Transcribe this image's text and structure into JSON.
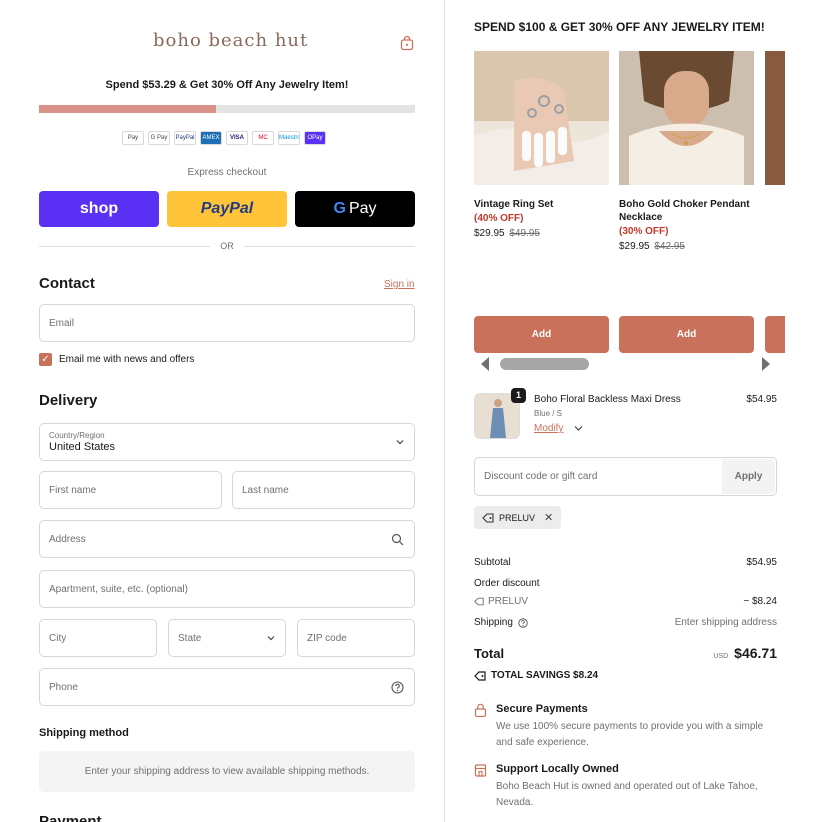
{
  "brand": "boho beach hut",
  "progress": {
    "text": "Spend $53.29 & Get 30% Off Any Jewelry Item!",
    "fraction": 0.47
  },
  "payment_icons": [
    "Pay",
    "G Pay",
    "PayPal",
    "AMEX",
    "VISA",
    "MC",
    "Maestro",
    "OPay"
  ],
  "express": {
    "label": "Express checkout",
    "shop": "shop",
    "paypal": "PayPal",
    "gpay": "Pay",
    "or": "OR"
  },
  "contact": {
    "heading": "Contact",
    "sign_in": "Sign in",
    "email_placeholder": "Email",
    "newsletter": "Email me with news and offers",
    "newsletter_checked": true
  },
  "delivery": {
    "heading": "Delivery",
    "country_caption": "Country/Region",
    "country_value": "United States",
    "first_name": "First name",
    "last_name": "Last name",
    "address": "Address",
    "apartment": "Apartment, suite, etc. (optional)",
    "city": "City",
    "state": "State",
    "zip": "ZIP code",
    "phone": "Phone"
  },
  "shipping_method": {
    "heading": "Shipping method",
    "message": "Enter your shipping address to view available shipping methods."
  },
  "payment_heading": "Payment",
  "upsell": {
    "title": "SPEND $100 & GET 30% OFF ANY JEWELRY ITEM!",
    "products": [
      {
        "name": "Vintage Ring Set",
        "discount": "(40% OFF)",
        "price": "$29.95",
        "compare": "$49.95",
        "button": "Add"
      },
      {
        "name": "Boho Gold Choker Pendant Necklace",
        "discount": "(30% OFF)",
        "price": "$29.95",
        "compare": "$42.95",
        "button": "Add"
      }
    ]
  },
  "cart": {
    "item": {
      "quantity": "1",
      "name": "Boho Floral Backless Maxi Dress",
      "variant": "Blue / S",
      "modify": "Modify",
      "price": "$54.95"
    },
    "discount_placeholder": "Discount code or gift card",
    "apply": "Apply",
    "applied_code": "PRELUV",
    "subtotal_label": "Subtotal",
    "subtotal": "$54.95",
    "order_discount_label": "Order discount",
    "discount_code": "PRELUV",
    "discount_amount": "− $8.24",
    "shipping_label": "Shipping",
    "shipping_value": "Enter shipping address",
    "total_label": "Total",
    "currency": "USD",
    "total": "$46.71",
    "savings": "TOTAL SAVINGS  $8.24"
  },
  "assurances": [
    {
      "title": "Secure Payments",
      "desc": "We use 100% secure payments to provide you with a simple and safe experience."
    },
    {
      "title": "Support Locally Owned",
      "desc": "Boho Beach Hut is owned and operated out of Lake Tahoe, Nevada."
    }
  ],
  "colors": {
    "accent": "#c9715b",
    "progress": "#d9928a",
    "shop": "#5a31f4",
    "paypal": "#ffc439"
  }
}
